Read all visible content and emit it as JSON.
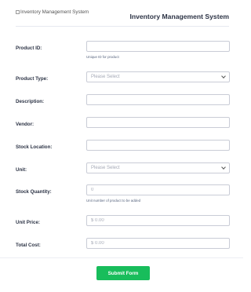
{
  "header": {
    "logo_alt": "Inventory Management System",
    "title": "Inventory Management System"
  },
  "form": {
    "product_id": {
      "label": "Product ID:",
      "value": "",
      "hint": "Unique ID for product"
    },
    "product_type": {
      "label": "Product Type:",
      "selected": "Please Select"
    },
    "description": {
      "label": "Description:",
      "value": ""
    },
    "vendor": {
      "label": "Vendor:",
      "value": ""
    },
    "stock_location": {
      "label": "Stock Location:",
      "value": ""
    },
    "unit": {
      "label": "Unit:",
      "selected": "Please Select"
    },
    "stock_quantity": {
      "label": "Stock Quantity:",
      "placeholder": "0",
      "hint": "Unit number of product to be added"
    },
    "unit_price": {
      "label": "Unit Price:",
      "placeholder": "$ 0.00"
    },
    "total_cost": {
      "label": "Total Cost:",
      "placeholder": "$ 0.00"
    }
  },
  "submit": {
    "label": "Submit Form"
  },
  "colors": {
    "submit_bg": "#18bd5b",
    "border": "#c9ccd6",
    "text": "#2c3345"
  }
}
